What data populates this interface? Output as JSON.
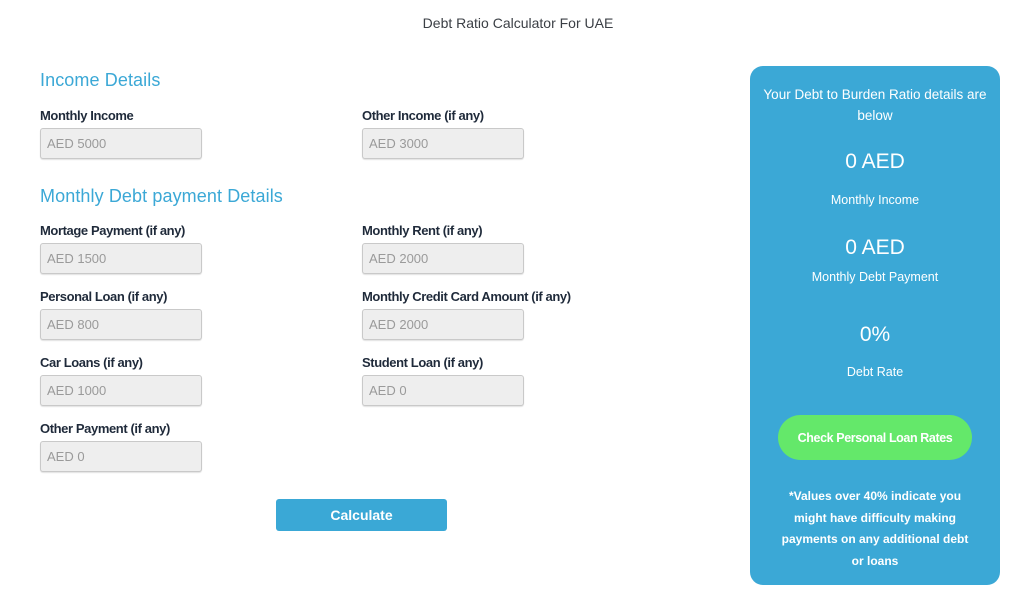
{
  "page": {
    "title": "Debt Ratio Calculator For UAE"
  },
  "income_section": {
    "title": "Income Details",
    "fields": [
      {
        "label": "Monthly Income",
        "placeholder": "AED 5000",
        "value": ""
      },
      {
        "label": "Other Income (if any)",
        "placeholder": "AED 3000",
        "value": ""
      }
    ]
  },
  "debt_section": {
    "title": "Monthly Debt payment Details",
    "fields": [
      {
        "label": "Mortage Payment (if any)",
        "placeholder": "AED 1500",
        "value": ""
      },
      {
        "label": "Monthly Rent (if any)",
        "placeholder": "AED 2000",
        "value": ""
      },
      {
        "label": "Personal Loan (if any)",
        "placeholder": "AED 800",
        "value": ""
      },
      {
        "label": "Monthly Credit Card Amount (if any)",
        "placeholder": "AED 2000",
        "value": ""
      },
      {
        "label": "Car Loans (if any)",
        "placeholder": "AED 1000",
        "value": ""
      },
      {
        "label": "Student Loan (if any)",
        "placeholder": "AED 0",
        "value": ""
      },
      {
        "label": "Other Payment (if any)",
        "placeholder": "AED 0",
        "value": ""
      }
    ]
  },
  "actions": {
    "calculate_label": "Calculate"
  },
  "results": {
    "heading": "Your Debt to Burden Ratio details are below",
    "monthly_income_value": "0 AED",
    "monthly_income_label": "Monthly Income",
    "monthly_debt_value": "0 AED",
    "monthly_debt_label": "Monthly Debt Payment",
    "debt_rate_value": "0%",
    "debt_rate_label": "Debt Rate",
    "loan_button_label": "Check Personal Loan Rates",
    "note": "*Values over 40% indicate you might have difficulty making payments on any additional debt or loans"
  },
  "colors": {
    "accent_blue": "#3ba8d6",
    "button_green": "#64e86a",
    "label_dark": "#1f2a3a"
  }
}
